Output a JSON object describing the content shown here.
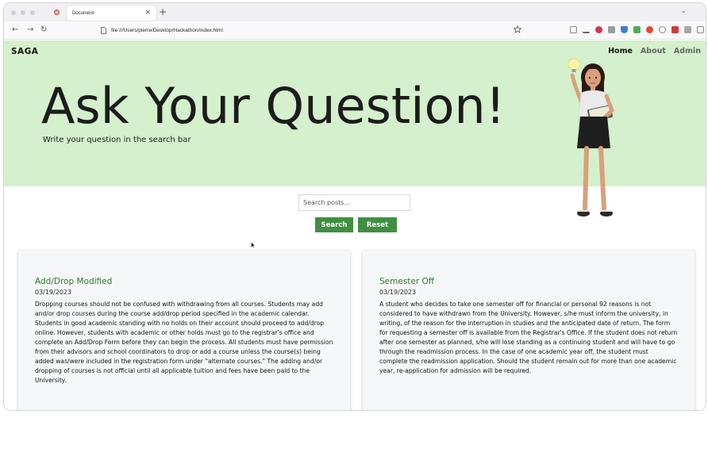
{
  "browser": {
    "tab_title": "Document",
    "tab_close": "×",
    "new_tab": "+",
    "tab_list": "⌄",
    "back": "←",
    "forward": "→",
    "reload": "↻",
    "url": "file:///Users/pierre/Desktop/Hackathon/index.html"
  },
  "site": {
    "brand": "SAGA",
    "nav": [
      {
        "label": "Home",
        "active": true
      },
      {
        "label": "About",
        "active": false
      },
      {
        "label": "Admin",
        "active": false
      }
    ]
  },
  "hero": {
    "title": "Ask Your Question!",
    "subtitle": "Write your question in the search bar",
    "background": "#d4f0cc"
  },
  "search": {
    "placeholder": "Search posts...",
    "search_label": "Search",
    "reset_label": "Reset",
    "button_color": "#3f8f42"
  },
  "posts": [
    {
      "title": "Add/Drop Modified",
      "date": "03/19/2023",
      "body": "Dropping courses should not be confused with withdrawing from all courses. Students may add and/or drop courses during the course add/drop period specified in the academic calendar. Students in good academic standing with no holds on their account should proceed to add/drop online. However, students with academic or other holds must go to the registrar's office and complete an Add/Drop Form before they can begin the process. All students must have permission from their advisors and school coordinators to drop or add a course unless the course(s) being added was/were included in the registration form under \"alternate courses.\" The adding and/or dropping of courses is not official until all applicable tuition and fees have been paid to the University."
    },
    {
      "title": "Semester Off",
      "date": "03/19/2023",
      "body": "A student who decides to take one semester off for financial or personal 92 reasons is not considered to have withdrawn from the University. However, s/he must inform the university, in writing, of the reason for the interruption in studies and the anticipated date of return. The form for requesting a semester off is available from the Registrar's Office. If the student does not return after one semester as planned, s/he will lose standing as a continuing student and will have to go through the readmission process. In the case of one academic year off, the student must complete the readmission application. Should the student remain out for more than one academic year, re-application for admission will be required."
    }
  ],
  "colors": {
    "post_title": "#2a7a22",
    "card_bg": "#f6f7f8"
  }
}
